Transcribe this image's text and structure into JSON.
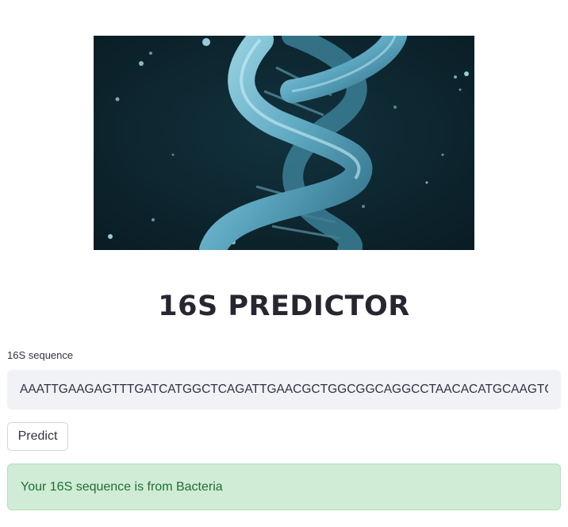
{
  "hero": {
    "icon": "dna-helix-image"
  },
  "title": "16S PREDICTOR",
  "input": {
    "label": "16S sequence",
    "value": "AAATTGAAGAGTTTGATCATGGCTCAGATTGAACGCTGGCGGCAGGCCTAACACATGCAAGTCGAACGGTAACAGGAAGAAGCTTGCTTCTTTGCTGACGAGTGGCGGACGGGTGAGTAATGTCTGGGAAACTGCCTGATGGAGGGGGATAACTACTGGAAACGGTAGCTAATACCGCATAACGTCGCAAGACCAAAGAGGGGGACCTTCGGGCCTCTTGCCATCGGATGTGCCCAGATGGGATTAGCTAGTAGGTGGGGTAACGGCTCACCTAGGCGACGATCCCTAGCTGGTCTGAGAGGATGACCAGCCACACTGGAACTGAGACACGGTCCAGACTCCTACGGGAGGCAGCAGTGGGGAATATTGCACAATGGGCGCAAGCCTGATGCAGCCATGCCGCGTGTATGAAGAAGGCCTTCGGGTTGTAAAGTACTTTCAGCGGGGAGGAAGG"
  },
  "button": {
    "label": "Predict"
  },
  "result": {
    "text": "Your 16S sequence is from Bacteria"
  },
  "colors": {
    "hero_background": "#0c222b",
    "helix": "#5fa9c2",
    "success_background": "#d0ecd6",
    "success_text": "#1e6e36"
  }
}
